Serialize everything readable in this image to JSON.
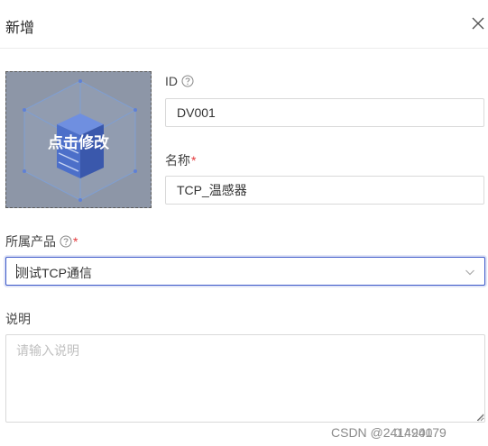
{
  "dialog": {
    "title": "新增",
    "close_icon": "close-icon"
  },
  "upload": {
    "label": "点击修改",
    "image_icon": "device-cube-icon"
  },
  "form": {
    "id": {
      "label": "ID",
      "help_icon": "question-circle-icon",
      "value": "DV001"
    },
    "name": {
      "label": "名称",
      "required_mark": "*",
      "value": "TCP_温感器"
    },
    "product": {
      "label": "所属产品",
      "help_icon": "question-circle-icon",
      "required_mark": "*",
      "selected": "测试TCP通信",
      "dropdown_icon": "chevron-down-icon"
    },
    "description": {
      "label": "说明",
      "placeholder": "请输入说明",
      "value": ""
    }
  },
  "watermark": {
    "text": "CSDN @241494179",
    "counter": "0 / 200"
  },
  "colors": {
    "accent": "#3b57c8",
    "required": "#e4393c",
    "upload_overlay": "#8d96a7"
  }
}
